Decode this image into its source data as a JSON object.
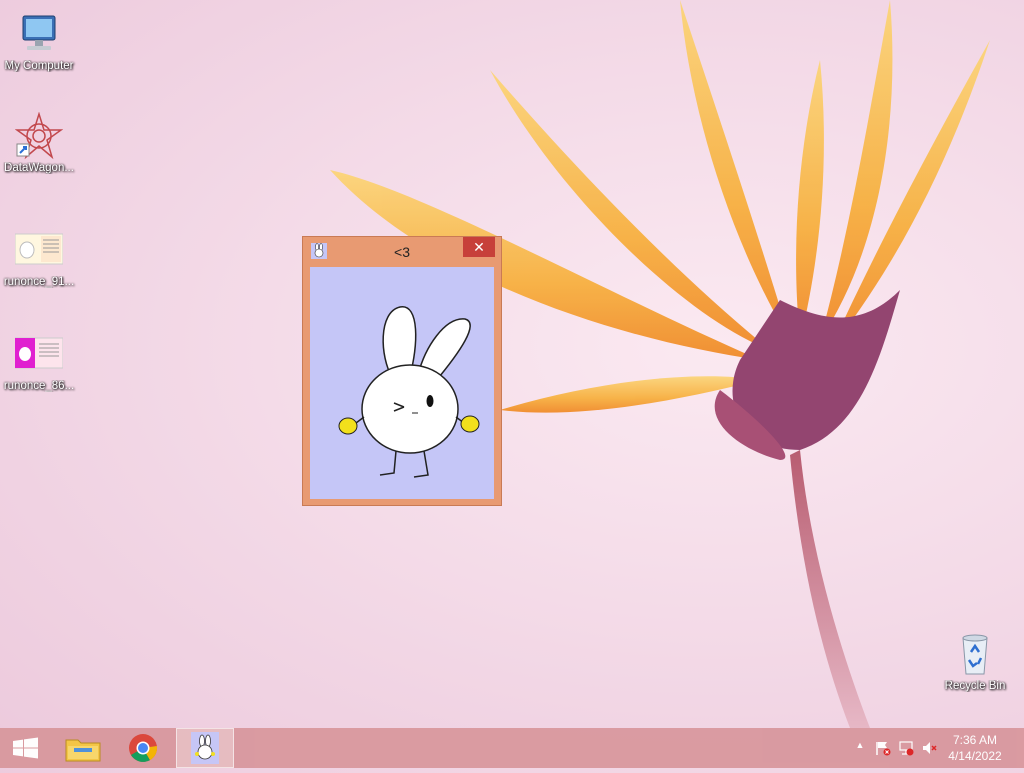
{
  "desktop": {
    "icons": [
      {
        "label": "My Computer"
      },
      {
        "label": "DataWagon..."
      },
      {
        "label": "runonce_91..."
      },
      {
        "label": "runonce_86..."
      },
      {
        "label": "Recycle Bin"
      }
    ]
  },
  "dialog": {
    "title": "<3",
    "close_glyph": "✕"
  },
  "taskbar": {
    "pinned": [
      "windows-start-icon",
      "file-explorer-icon",
      "chrome-icon",
      "bunny-app-icon"
    ],
    "tray": {
      "show_hidden_glyph": "▲",
      "time": "7:36 AM",
      "date": "4/14/2022"
    }
  }
}
